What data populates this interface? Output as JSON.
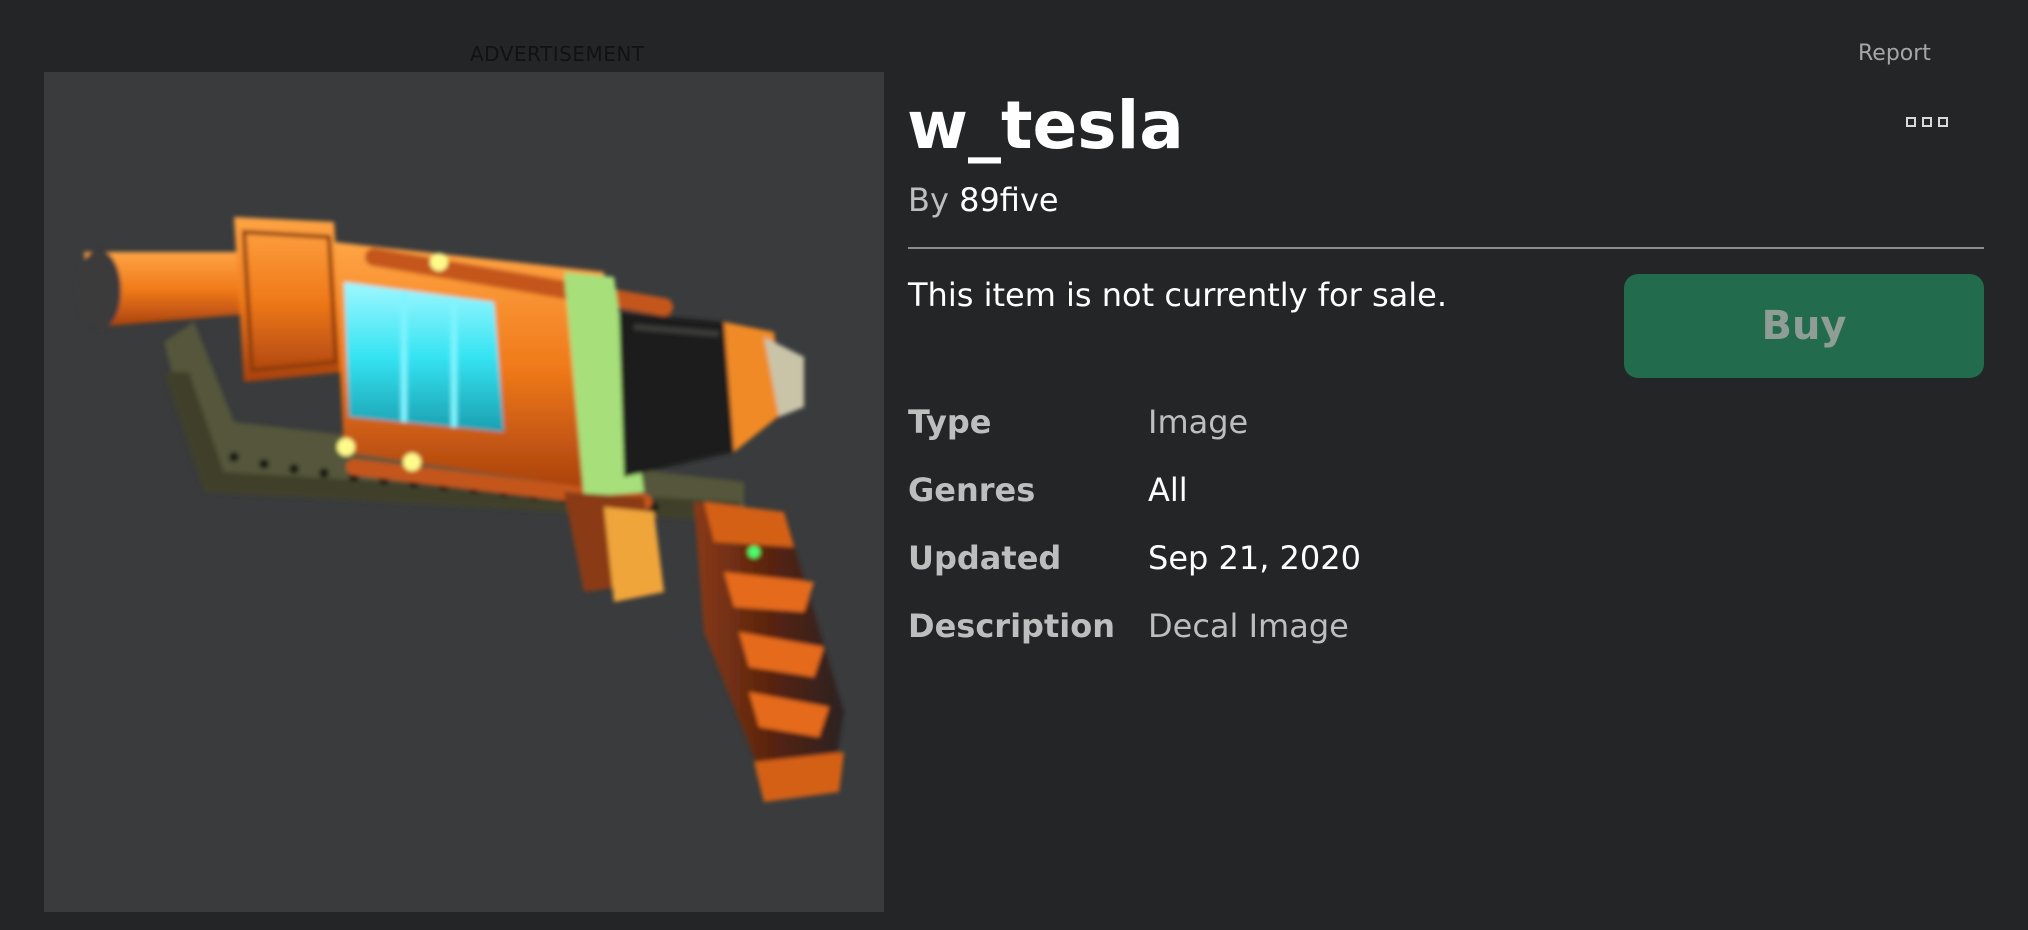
{
  "advertisement_label": "ADVERTISEMENT",
  "report_label": "Report",
  "item": {
    "title": "w_tesla",
    "by_prefix": "By",
    "creator": "89five",
    "sale_status": "This item is not currently for sale.",
    "buy_label": "Buy"
  },
  "details": [
    {
      "label": "Type",
      "value": "Image"
    },
    {
      "label": "Genres",
      "value": "All"
    },
    {
      "label": "Updated",
      "value": "Sep 21, 2020"
    },
    {
      "label": "Description",
      "value": "Decal Image"
    }
  ],
  "colors": {
    "page_background": "#232527",
    "preview_background": "#393b3d",
    "buy_button": "#226b4c",
    "divider": "#8b8c8d"
  }
}
